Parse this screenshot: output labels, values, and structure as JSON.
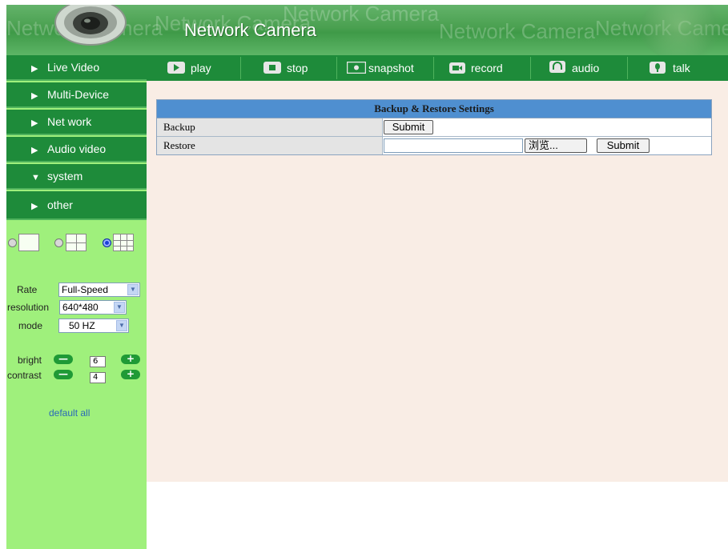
{
  "header": {
    "title": "Network Camera",
    "watermark": "Network Camera"
  },
  "sidebar": {
    "items": [
      {
        "label": "Live Video",
        "arrow": "▶"
      },
      {
        "label": "Multi-Device",
        "arrow": "▶"
      },
      {
        "label": "Net work",
        "arrow": "▶"
      },
      {
        "label": "Audio video",
        "arrow": "▶"
      },
      {
        "label": "system",
        "arrow": "▼"
      },
      {
        "label": "other",
        "arrow": "▶"
      }
    ],
    "layout_selected": "9-grid",
    "controls": {
      "rate_label": "Rate",
      "rate_value": "Full-Speed",
      "resolution_label": "resolution",
      "resolution_value": "640*480",
      "mode_label": "mode",
      "mode_value": "50 HZ",
      "bright_label": "bright",
      "bright_value": "6",
      "contrast_label": "contrast",
      "contrast_value": "4",
      "minus": "—",
      "plus": "+",
      "default_link": "default all"
    }
  },
  "toolbar": {
    "play": "play",
    "stop": "stop",
    "snapshot": "snapshot",
    "record": "record",
    "audio": "audio",
    "talk": "talk"
  },
  "settings": {
    "title": "Backup & Restore Settings",
    "backup_label": "Backup",
    "backup_button": "Submit",
    "restore_label": "Restore",
    "browse_button": "浏览...",
    "restore_button": "Submit"
  },
  "colors": {
    "nav_green": "#1e8b3a",
    "sidebar_bg": "#9ff07c",
    "content_bg": "#f9ede5",
    "table_header": "#4f8fd0"
  }
}
